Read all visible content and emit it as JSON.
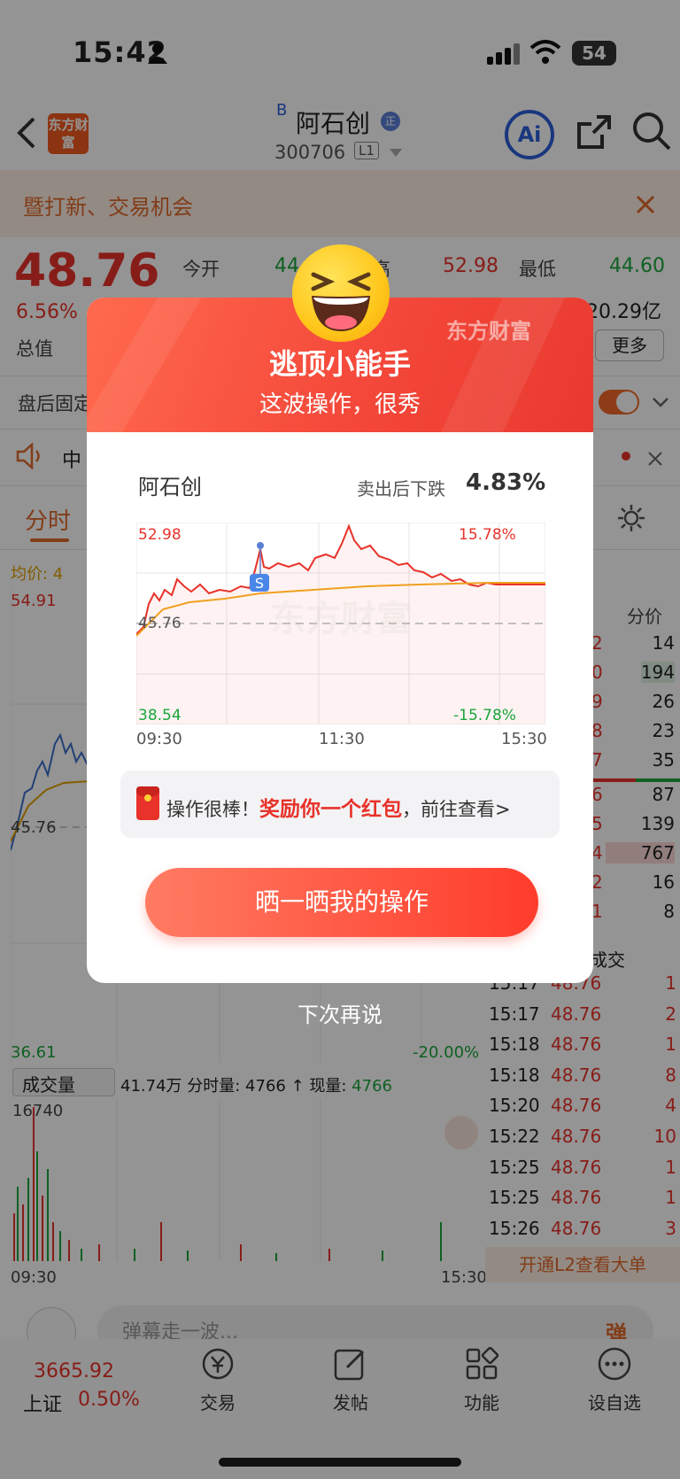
{
  "status": {
    "time": "15:42",
    "battery": "54"
  },
  "header": {
    "logo_text": "东方财富",
    "stock_prefix": "B",
    "stock_name": "阿石创",
    "stock_badge": "正",
    "stock_code": "300706",
    "level_badge": "L1",
    "ai_label": "Ai"
  },
  "banner": {
    "text": "暨打新、交易机会"
  },
  "quote": {
    "price": "48.76",
    "pct": "6.56%",
    "total_label": "总值",
    "open_label": "今开",
    "open_val": "44",
    "high_label": "高",
    "high_val": "52.98",
    "low_label": "最低",
    "low_val": "44.60",
    "cap_val": "20.29亿",
    "more": "更多",
    "after_hours": "盘后固定",
    "news_prefix": "中"
  },
  "chart": {
    "tab_timeshare": "分时",
    "avg_label": "均价: 4",
    "top_val": "54.91",
    "mid_val": "45.76",
    "bottom_val": "36.61",
    "bottom_pct": "-20.00%",
    "volume_tab": "成交量",
    "volume_info_1": "41.74万 分时量: 4766 ↑ 现量:",
    "volume_now": "4766",
    "vol_max": "16740",
    "time_start": "09:30",
    "time_end": "15:30"
  },
  "orderbook": {
    "head_right": "分价",
    "rows": [
      {
        "a": "2",
        "b": "14"
      },
      {
        "a": "0",
        "b": "194"
      },
      {
        "a": "9",
        "b": "26"
      },
      {
        "a": "8",
        "b": "23"
      },
      {
        "a": "7",
        "b": "35"
      },
      {
        "a": "6",
        "b": "87"
      },
      {
        "a": "5",
        "b": "139"
      },
      {
        "a": "4",
        "b": "767"
      },
      {
        "a": "2",
        "b": "16"
      },
      {
        "a": "1",
        "b": "8"
      }
    ],
    "trades_label": "成交",
    "trades": [
      {
        "t": "15:17",
        "p": "48.76",
        "v": "1"
      },
      {
        "t": "15:17",
        "p": "48.76",
        "v": "2"
      },
      {
        "t": "15:18",
        "p": "48.76",
        "v": "1"
      },
      {
        "t": "15:18",
        "p": "48.76",
        "v": "8"
      },
      {
        "t": "15:20",
        "p": "48.76",
        "v": "4"
      },
      {
        "t": "15:22",
        "p": "48.76",
        "v": "10"
      },
      {
        "t": "15:25",
        "p": "48.76",
        "v": "1"
      },
      {
        "t": "15:25",
        "p": "48.76",
        "v": "1"
      },
      {
        "t": "15:26",
        "p": "48.76",
        "v": "3"
      }
    ],
    "l2_promo": "开通L2查看大单"
  },
  "comment": {
    "placeholder": "弹幕走一波...",
    "danmu_btn": "弹"
  },
  "tabbar": {
    "index_val": "3665.92",
    "index_name": "上证",
    "index_pct": "0.50%",
    "tabs": [
      "交易",
      "发帖",
      "功能",
      "设自选"
    ]
  },
  "modal": {
    "brand": "东方财富",
    "title": "逃顶小能手",
    "subtitle": "这波操作，很秀",
    "stock": "阿石创",
    "drop_label": "卖出后下跌",
    "drop_val": "4.83%",
    "chart_top": "52.98",
    "chart_top_pct": "15.78%",
    "chart_mid": "45.76",
    "chart_bottom": "38.54",
    "chart_bottom_pct": "-15.78%",
    "chart_t0": "09:30",
    "chart_t1": "11:30",
    "chart_t2": "15:30",
    "sell_marker": "S",
    "watermark": "东方财富",
    "reward_prefix": "操作很棒！",
    "reward_highlight": "奖励你一个红包",
    "reward_suffix": "，前往查看>",
    "share_btn": "晒一晒我的操作",
    "later": "下次再说"
  },
  "colors": {
    "up": "#e8322a",
    "down": "#1aa63c",
    "accent": "#ff3c2c",
    "ai": "#2b5fd9"
  }
}
